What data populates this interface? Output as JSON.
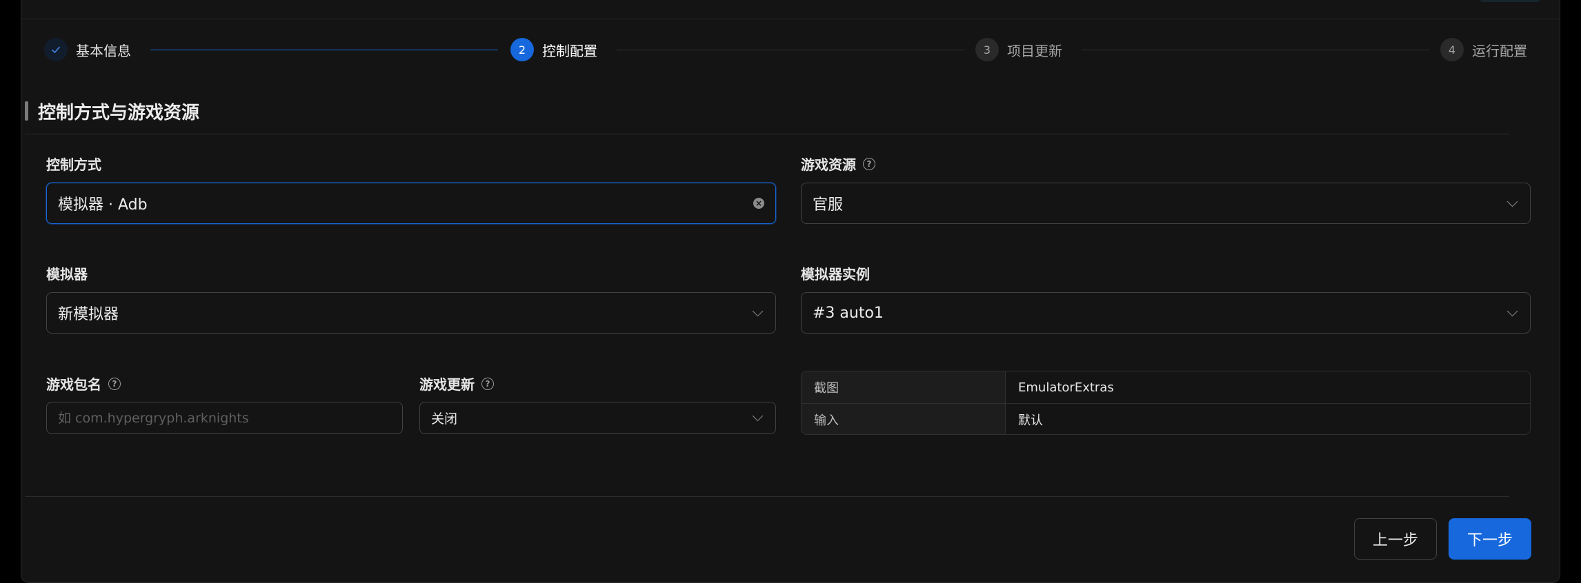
{
  "steps": [
    {
      "index": "1",
      "label": "基本信息",
      "status": "done"
    },
    {
      "index": "2",
      "label": "控制配置",
      "status": "active"
    },
    {
      "index": "3",
      "label": "项目更新",
      "status": "wait"
    },
    {
      "index": "4",
      "label": "运行配置",
      "status": "wait"
    }
  ],
  "section": {
    "title": "控制方式与游戏资源"
  },
  "fields": {
    "control_mode": {
      "label": "控制方式",
      "value": "模拟器 · Adb"
    },
    "game_resource": {
      "label": "游戏资源",
      "value": "官服"
    },
    "emulator": {
      "label": "模拟器",
      "value": "新模拟器"
    },
    "emulator_instance": {
      "label": "模拟器实例",
      "value": "#3 auto1"
    },
    "package_name": {
      "label": "游戏包名",
      "placeholder": "如 com.hypergryph.arknights",
      "value": ""
    },
    "game_update": {
      "label": "游戏更新",
      "value": "关闭"
    }
  },
  "details": [
    {
      "key": "截图",
      "value": "EmulatorExtras"
    },
    {
      "key": "输入",
      "value": "默认"
    }
  ],
  "footer": {
    "prev_label": "上一步",
    "next_label": "下一步"
  },
  "colors": {
    "primary": "#1668dc",
    "background": "#141414",
    "border": "#424242"
  }
}
